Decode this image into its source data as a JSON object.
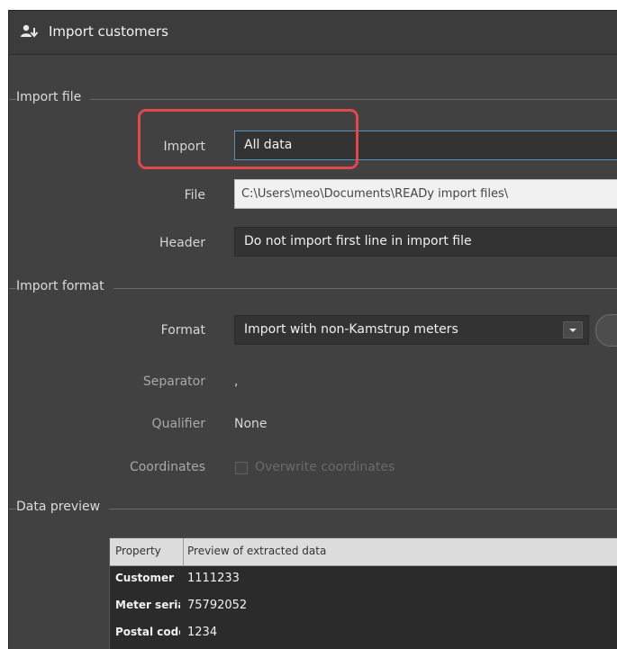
{
  "window": {
    "title": "Import customers",
    "icon": "import-customers-icon"
  },
  "sections": {
    "import_file": "Import file",
    "import_format": "Import format",
    "data_preview": "Data preview"
  },
  "import_file": {
    "import_label": "Import",
    "import_value": "All data",
    "file_label": "File",
    "file_value": "C:\\Users\\meo\\Documents\\READy import files\\",
    "header_label": "Header",
    "header_value": "Do not import first line in import file"
  },
  "import_format": {
    "format_label": "Format",
    "format_value": "Import with non-Kamstrup meters",
    "separator_label": "Separator",
    "separator_value": ",",
    "qualifier_label": "Qualifier",
    "qualifier_value": "None",
    "coordinates_label": "Coordinates",
    "overwrite_label": "Overwrite coordinates",
    "overwrite_checked": false
  },
  "preview": {
    "columns": [
      "Property",
      "Preview of extracted data"
    ],
    "rows": [
      {
        "property": "Customer",
        "value": "1111233"
      },
      {
        "property": "Meter serial",
        "value": "75792052"
      },
      {
        "property": "Postal code",
        "value": "1234"
      }
    ]
  },
  "colors": {
    "window_bg": "#414141",
    "field_bg": "#333333",
    "highlight": "#e0484c",
    "focus_border": "#5b8fbf"
  }
}
